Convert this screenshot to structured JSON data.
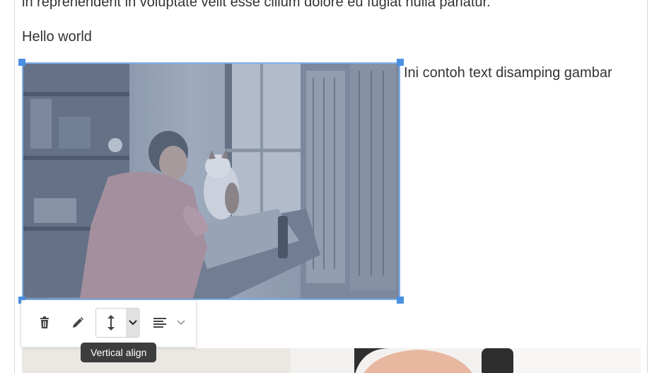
{
  "content": {
    "paragraph_top": "in reprehenderit in voluptate velit esse cillum dolore eu fugiat nulla pariatur.",
    "hello": "Hello world",
    "side_text": "Ini contoh text disamping gambar"
  },
  "image_toolbar": {
    "delete_icon": "trash-icon",
    "edit_icon": "pencil-icon",
    "valign_icon": "vertical-align-icon",
    "valign_caret_icon": "chevron-down-icon",
    "halign_icon": "align-left-icon",
    "halign_caret_icon": "chevron-down-icon"
  },
  "tooltip": {
    "text": "Vertical align"
  },
  "colors": {
    "selection": "#7fb1ea",
    "handle": "#4a90e2",
    "tooltip_bg": "#3d3d3d"
  }
}
